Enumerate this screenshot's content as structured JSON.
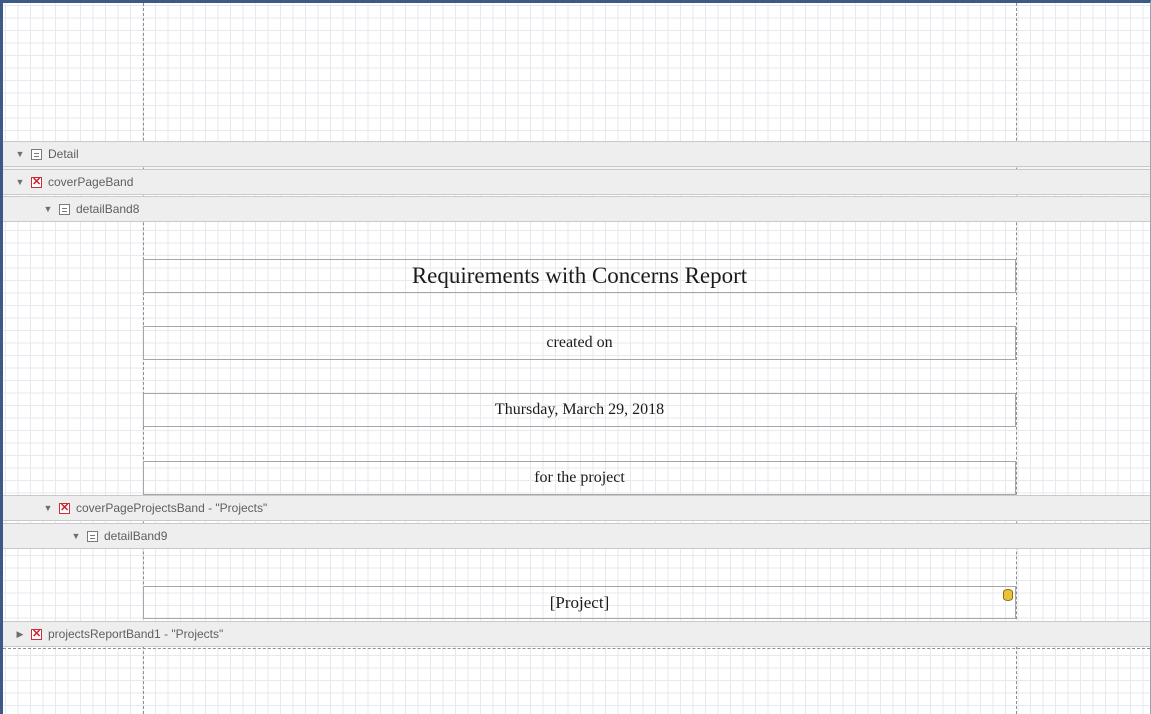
{
  "bands": [
    {
      "label": "Detail",
      "icon": "detail-band-icon",
      "expanded": true
    },
    {
      "label": "coverPageBand",
      "icon": "delete-x-icon",
      "expanded": true
    },
    {
      "label": "detailBand8",
      "icon": "detail-band-icon",
      "expanded": true
    },
    {
      "label": "coverPageProjectsBand - \"Projects\"",
      "icon": "delete-x-icon",
      "expanded": true
    },
    {
      "label": "detailBand9",
      "icon": "detail-band-icon",
      "expanded": true
    },
    {
      "label": "projectsReportBand1 - \"Projects\"",
      "icon": "delete-x-icon",
      "expanded": false
    }
  ],
  "labels": {
    "title": "Requirements with Concerns Report",
    "created_on": "created on",
    "date": "Thursday, March 29, 2018",
    "for_project": "for the project",
    "project_field": "[Project]"
  },
  "icons": {
    "expanded": "▼",
    "collapsed": "▶",
    "x": "✕"
  },
  "colors": {
    "frame_border": "#3c5a85",
    "band_background": "#eeeeee",
    "delete_icon": "#d0202c",
    "data_binding_icon": "#e8c23a"
  }
}
